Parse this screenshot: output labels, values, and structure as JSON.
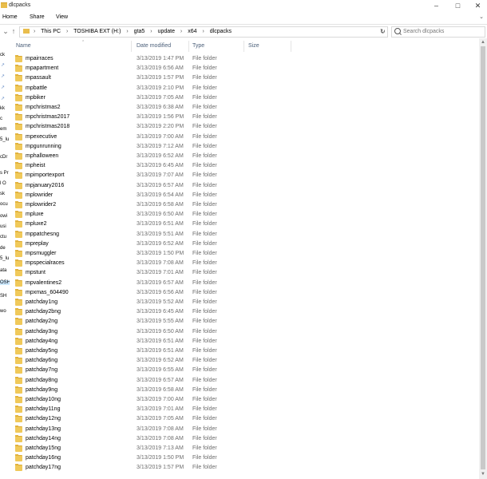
{
  "window": {
    "title": "dlcpacks"
  },
  "ribbon": {
    "tabs": [
      "Home",
      "Share",
      "View"
    ]
  },
  "address": {
    "crumbs": [
      "This PC",
      "TOSHIBA EXT (H:)",
      "gta5",
      "update",
      "x64",
      "dlcpacks"
    ]
  },
  "search": {
    "placeholder": "Search dlcpacks"
  },
  "columns": {
    "name": "Name",
    "date": "Date modified",
    "type": "Type",
    "size": "Size"
  },
  "navpane": {
    "items": [
      "ck",
      "",
      "",
      "",
      "",
      "",
      "kk",
      "c",
      "em",
      "5_lu",
      "cDr",
      "",
      "s Pr",
      "l O",
      "sk",
      "ocu",
      "owi",
      "usi",
      "ctu",
      "de",
      "5_lu",
      "ata",
      "OSH",
      "SH",
      "wo"
    ]
  },
  "files": [
    {
      "name": "mpairraces",
      "date": "3/13/2019 1:47 PM",
      "type": "File folder"
    },
    {
      "name": "mpapartment",
      "date": "3/13/2019 6:56 AM",
      "type": "File folder"
    },
    {
      "name": "mpassault",
      "date": "3/13/2019 1:57 PM",
      "type": "File folder"
    },
    {
      "name": "mpbattle",
      "date": "3/13/2019 2:10 PM",
      "type": "File folder"
    },
    {
      "name": "mpbiker",
      "date": "3/13/2019 7:05 AM",
      "type": "File folder"
    },
    {
      "name": "mpchristmas2",
      "date": "3/13/2019 6:38 AM",
      "type": "File folder"
    },
    {
      "name": "mpchristmas2017",
      "date": "3/13/2019 1:56 PM",
      "type": "File folder"
    },
    {
      "name": "mpchristmas2018",
      "date": "3/13/2019 2:20 PM",
      "type": "File folder"
    },
    {
      "name": "mpexecutive",
      "date": "3/13/2019 7:00 AM",
      "type": "File folder"
    },
    {
      "name": "mpgunrunning",
      "date": "3/13/2019 7:12 AM",
      "type": "File folder"
    },
    {
      "name": "mphalloween",
      "date": "3/13/2019 6:52 AM",
      "type": "File folder"
    },
    {
      "name": "mpheist",
      "date": "3/13/2019 6:45 AM",
      "type": "File folder"
    },
    {
      "name": "mpimportexport",
      "date": "3/13/2019 7:07 AM",
      "type": "File folder"
    },
    {
      "name": "mpjanuary2016",
      "date": "3/13/2019 6:57 AM",
      "type": "File folder"
    },
    {
      "name": "mplowrider",
      "date": "3/13/2019 6:54 AM",
      "type": "File folder"
    },
    {
      "name": "mplowrider2",
      "date": "3/13/2019 6:58 AM",
      "type": "File folder"
    },
    {
      "name": "mpluxe",
      "date": "3/13/2019 6:50 AM",
      "type": "File folder"
    },
    {
      "name": "mpluxe2",
      "date": "3/13/2019 6:51 AM",
      "type": "File folder"
    },
    {
      "name": "mppatchesng",
      "date": "3/13/2019 5:51 AM",
      "type": "File folder"
    },
    {
      "name": "mpreplay",
      "date": "3/13/2019 6:52 AM",
      "type": "File folder"
    },
    {
      "name": "mpsmuggler",
      "date": "3/13/2019 1:50 PM",
      "type": "File folder"
    },
    {
      "name": "mpspecialraces",
      "date": "3/13/2019 7:08 AM",
      "type": "File folder"
    },
    {
      "name": "mpstunt",
      "date": "3/13/2019 7:01 AM",
      "type": "File folder"
    },
    {
      "name": "mpvalentines2",
      "date": "3/13/2019 6:57 AM",
      "type": "File folder"
    },
    {
      "name": "mpxmas_604490",
      "date": "3/13/2019 6:56 AM",
      "type": "File folder"
    },
    {
      "name": "patchday1ng",
      "date": "3/13/2019 5:52 AM",
      "type": "File folder"
    },
    {
      "name": "patchday2bng",
      "date": "3/13/2019 6:45 AM",
      "type": "File folder"
    },
    {
      "name": "patchday2ng",
      "date": "3/13/2019 5:55 AM",
      "type": "File folder"
    },
    {
      "name": "patchday3ng",
      "date": "3/13/2019 6:50 AM",
      "type": "File folder"
    },
    {
      "name": "patchday4ng",
      "date": "3/13/2019 6:51 AM",
      "type": "File folder"
    },
    {
      "name": "patchday5ng",
      "date": "3/13/2019 6:51 AM",
      "type": "File folder"
    },
    {
      "name": "patchday6ng",
      "date": "3/13/2019 6:52 AM",
      "type": "File folder"
    },
    {
      "name": "patchday7ng",
      "date": "3/13/2019 6:55 AM",
      "type": "File folder"
    },
    {
      "name": "patchday8ng",
      "date": "3/13/2019 6:57 AM",
      "type": "File folder"
    },
    {
      "name": "patchday9ng",
      "date": "3/13/2019 6:58 AM",
      "type": "File folder"
    },
    {
      "name": "patchday10ng",
      "date": "3/13/2019 7:00 AM",
      "type": "File folder"
    },
    {
      "name": "patchday11ng",
      "date": "3/13/2019 7:01 AM",
      "type": "File folder"
    },
    {
      "name": "patchday12ng",
      "date": "3/13/2019 7:05 AM",
      "type": "File folder"
    },
    {
      "name": "patchday13ng",
      "date": "3/13/2019 7:08 AM",
      "type": "File folder"
    },
    {
      "name": "patchday14ng",
      "date": "3/13/2019 7:08 AM",
      "type": "File folder"
    },
    {
      "name": "patchday15ng",
      "date": "3/13/2019 7:13 AM",
      "type": "File folder"
    },
    {
      "name": "patchday16ng",
      "date": "3/13/2019 1:50 PM",
      "type": "File folder"
    },
    {
      "name": "patchday17ng",
      "date": "3/13/2019 1:57 PM",
      "type": "File folder"
    }
  ]
}
